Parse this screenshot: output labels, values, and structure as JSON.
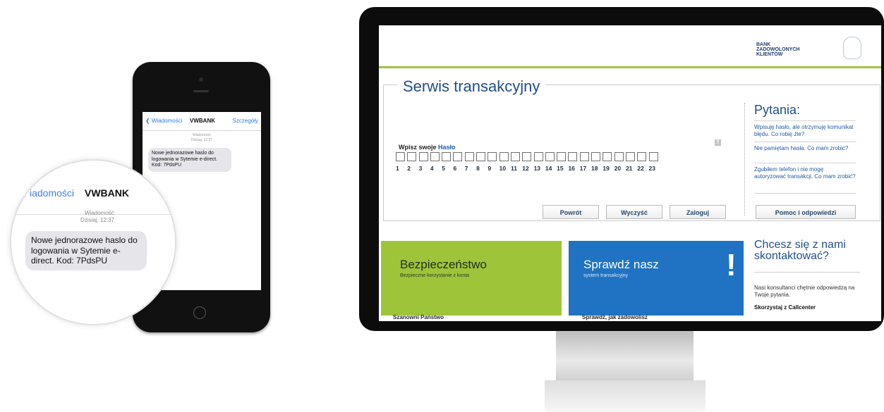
{
  "phone": {
    "back_label": "Wiadomości",
    "sender": "VWBANK",
    "details_label": "Szczegóły",
    "meta_label": "Wiadomość",
    "meta_time": "Dzisiaj, 12:37",
    "message": "Nowe jednorazowe haslo do logowania w Sytemie e-direct. Kod: 7PdsPU"
  },
  "magnifier": {
    "back_label": "iadomości",
    "sender": "VWBANK",
    "meta_label": "Wiadomość",
    "meta_time": "Dzisiaj, 12:37",
    "message": "Nowe jednorazowe haslo do logowania w Sytemie e-direct. Kod: 7PdsPU"
  },
  "website": {
    "logo_line1": "BANK",
    "logo_line2": "ZADOWOLONYCH",
    "logo_line3": "KLIENTÓW",
    "panel_title": "Serwis transakcyjny",
    "password_label_prefix": "Wpisz swoje",
    "password_label_word": "Hasło",
    "help_glyph": "?",
    "password_positions": [
      "1",
      "2",
      "3",
      "4",
      "5",
      "6",
      "7",
      "8",
      "9",
      "10",
      "11",
      "12",
      "13",
      "14",
      "15",
      "16",
      "17",
      "18",
      "19",
      "20",
      "21",
      "22",
      "23"
    ],
    "buttons": {
      "back": "Powrót",
      "clear": "Wyczyść",
      "login": "Zaloguj",
      "help": "Pomoc i odpowiedzi"
    },
    "questions_title": "Pytania:",
    "questions": [
      "Wpisuję hasło, ale otrzymuję komunikat błędu. Co robię źle?",
      "Nie pamiętam hasła. Co mam zrobić?",
      "Zgubiłem telefon i nie mogę autoryzować transakcji. Co mam zrobić?"
    ],
    "security_tile_title": "Bezpieczeństwo",
    "security_tile_sub": "Bezpieczne korzystanie z konta",
    "check_tile_title": "Sprawdź nasz",
    "check_tile_sub": "system transakcyjny",
    "check_tile_bang": "!",
    "contact_title": "Chcesz się z nami skontaktować?",
    "contact_text": "Nasi konsultanci chętnie odpowiedzą na Twoje pytania.",
    "contact_call": "Skorzystaj z Callcenter",
    "bottom_left": "Szanowni Państwo",
    "bottom_mid": "Sprawdź, jak zadowolisz"
  },
  "colors": {
    "accent_green": "#9ec43a",
    "accent_blue": "#1f73c2",
    "title_blue": "#1f4e87",
    "link_blue": "#1f5aa8",
    "ios_blue": "#2a7cf6"
  }
}
